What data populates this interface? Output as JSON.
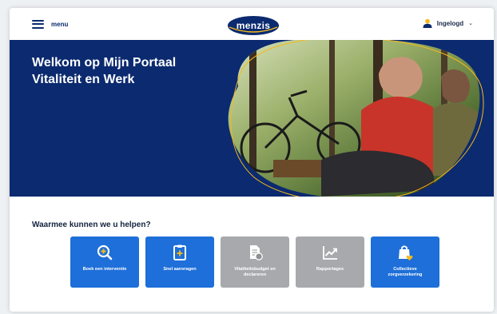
{
  "header": {
    "menu_label": "menu",
    "logo_text": "menzis",
    "account_label": "Ingelogd"
  },
  "hero": {
    "title_line1": "Welkom op Mijn Portaal",
    "title_line2": "Vitaliteit en Werk"
  },
  "help": {
    "title": "Waarmee kunnen we u helpen?",
    "tiles": [
      {
        "label_line1": "Boek een interventie",
        "label_line2": "",
        "icon": "search-plus-icon",
        "state": "active"
      },
      {
        "label_line1": "Snel aanvragen",
        "label_line2": "",
        "icon": "clipboard-plus-icon",
        "state": "active"
      },
      {
        "label_line1": "Vitaliteitsbudget en",
        "label_line2": "declareren",
        "icon": "document-coin-icon",
        "state": "disabled"
      },
      {
        "label_line1": "Rapportages",
        "label_line2": "",
        "icon": "chart-trend-icon",
        "state": "disabled"
      },
      {
        "label_line1": "Collectieve",
        "label_line2": "zorgverzekering",
        "icon": "bag-heart-icon",
        "state": "active"
      }
    ]
  },
  "colors": {
    "brand_navy": "#0b2a6f",
    "tile_blue": "#1e6fd9",
    "tile_grey": "#a7a9ac",
    "accent_yellow": "#f6b91a"
  }
}
